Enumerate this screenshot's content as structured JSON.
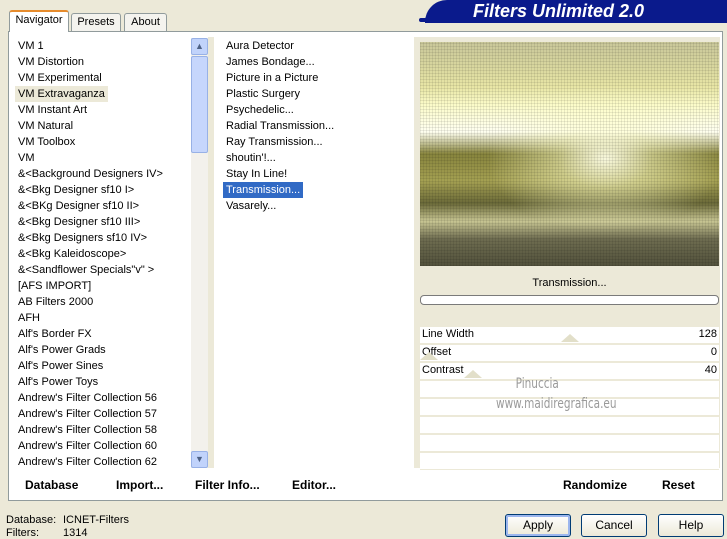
{
  "app": {
    "title": "Filters Unlimited 2.0"
  },
  "tabs": [
    {
      "label": "Navigator"
    },
    {
      "label": "Presets"
    },
    {
      "label": "About"
    }
  ],
  "categories": [
    "VM 1",
    "VM Distortion",
    "VM Experimental",
    "VM Extravaganza",
    "VM Instant Art",
    "VM Natural",
    "VM Toolbox",
    "VM",
    "&<Background Designers IV>",
    "&<Bkg Designer sf10 I>",
    "&<BKg Designer sf10 II>",
    "&<Bkg Designer sf10 III>",
    "&<Bkg Designers sf10 IV>",
    "&<Bkg Kaleidoscope>",
    "&<Sandflower Specials\"v\" >",
    "[AFS IMPORT]",
    "AB Filters 2000",
    "AFH",
    "Alf's Border FX",
    "Alf's Power Grads",
    "Alf's Power Sines",
    "Alf's Power Toys",
    "Andrew's Filter Collection 56",
    "Andrew's Filter Collection 57",
    "Andrew's Filter Collection 58",
    "Andrew's Filter Collection 60",
    "Andrew's Filter Collection 62"
  ],
  "selected_category": "VM Extravaganza",
  "filters": [
    " Aura Detector",
    "James Bondage...",
    "Picture in a Picture",
    "Plastic Surgery",
    "Psychedelic...",
    "Radial Transmission...",
    "Ray Transmission...",
    "shoutin'!...",
    "Stay In Line!",
    "Transmission...",
    "Vasarely..."
  ],
  "selected_filter": "Transmission...",
  "current_filter": "Transmission...",
  "progress": 0,
  "parameters": [
    {
      "label": "Line Width",
      "value": 128,
      "max": 255
    },
    {
      "label": "Offset",
      "value": 0,
      "max": 255
    },
    {
      "label": "Contrast",
      "value": 40,
      "max": 255
    }
  ],
  "watermark": [
    "Pinuccia",
    "www.maidiregrafica.eu"
  ],
  "bottom_buttons": {
    "database": "Database",
    "import": "Import...",
    "filter_info": "Filter Info...",
    "editor": "Editor...",
    "randomize": "Randomize",
    "reset": "Reset"
  },
  "status": {
    "database_label": "Database:",
    "database_value": "ICNET-Filters",
    "filters_label": "Filters:",
    "filters_value": "1314"
  },
  "dialog_buttons": {
    "apply": "Apply",
    "cancel": "Cancel",
    "help": "Help"
  }
}
